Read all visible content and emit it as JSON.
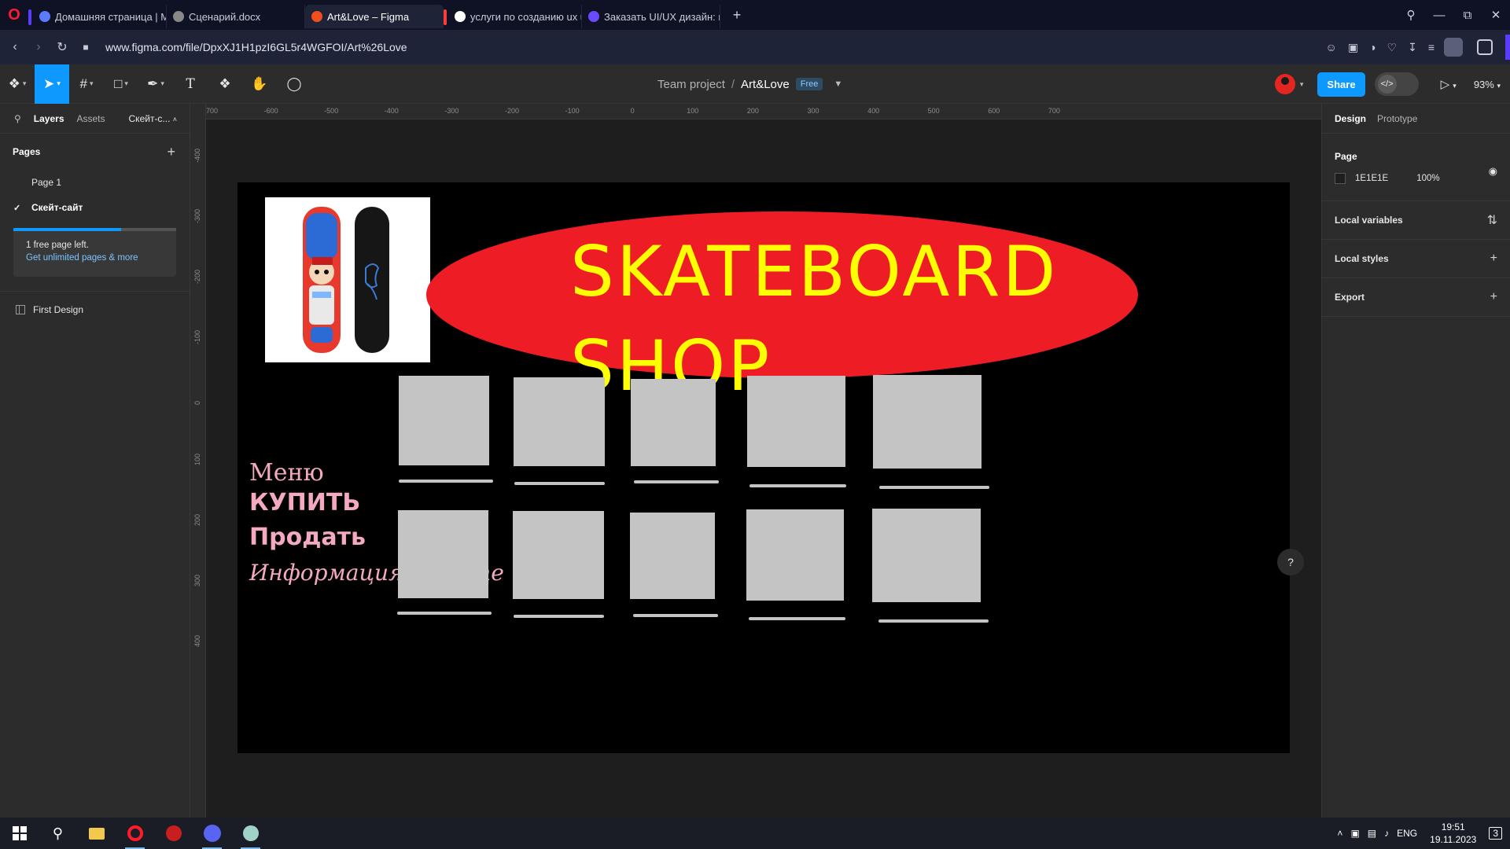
{
  "browser": {
    "tabs": [
      {
        "label": "Домашняя страница | Мо",
        "accent": "#5b3cff",
        "fav_color": "#5b7cff",
        "active": false
      },
      {
        "label": "Сценарий.docx",
        "accent": "",
        "fav_color": "#888888",
        "active": false
      },
      {
        "label": "Art&Love – Figma",
        "accent": "",
        "fav_color": "#f24e1e",
        "active": true
      },
      {
        "label": "услуги по созданию ux ui",
        "accent": "#ff3b3b",
        "fav_color": "#ffffff",
        "active": false
      },
      {
        "label": "Заказать UI/UX дизайн: п",
        "accent": "",
        "fav_color": "#6b4bff",
        "active": false
      }
    ],
    "url": "www.figma.com/file/DpxXJ1H1pzI6GL5r4WGFOI/Art%26Love"
  },
  "figma": {
    "file": {
      "team": "Team project",
      "separator": "/",
      "name": "Art&Love",
      "badge": "Free"
    },
    "share_label": "Share",
    "zoom": "93%",
    "left_panel": {
      "tab_layers": "Layers",
      "tab_assets": "Assets",
      "page_selector": "Скейт-с...",
      "pages_header": "Pages",
      "pages": [
        {
          "label": "Page 1",
          "selected": false
        },
        {
          "label": "Скейт-сайт",
          "selected": true
        }
      ],
      "promo_line1": "1 free page left.",
      "promo_line2": "Get unlimited pages & more",
      "promo_progress": 0.66,
      "layers": [
        {
          "label": "First Design"
        }
      ]
    },
    "right_panel": {
      "tab_design": "Design",
      "tab_prototype": "Prototype",
      "page_header": "Page",
      "page_color": "1E1E1E",
      "page_opacity": "100%",
      "sections": [
        "Local variables",
        "Local styles",
        "Export"
      ]
    },
    "rulers": {
      "top": [
        "-700",
        "-600",
        "-500",
        "-400",
        "-300",
        "-200",
        "-100",
        "0",
        "100",
        "200",
        "300",
        "400",
        "500",
        "600",
        "700"
      ],
      "left": [
        "-400",
        "-300",
        "-200",
        "-100",
        "0",
        "100",
        "200",
        "300",
        "400"
      ]
    },
    "design": {
      "title_line1": "SKATEBOARD",
      "title_line2": "SHOP",
      "menu_title": "Меню",
      "menu_buy": "КУПИТЬ",
      "menu_sell": "Продать",
      "menu_info": "Информация о сайте",
      "colors": {
        "ellipse": "#ee1c25",
        "title": "#ffff00",
        "menu": "#f4a9c0",
        "tile": "#c4c4c4"
      }
    },
    "help_label": "?"
  },
  "taskbar": {
    "language": "ENG",
    "time": "19:51",
    "date": "19.11.2023",
    "notifications": "3"
  }
}
